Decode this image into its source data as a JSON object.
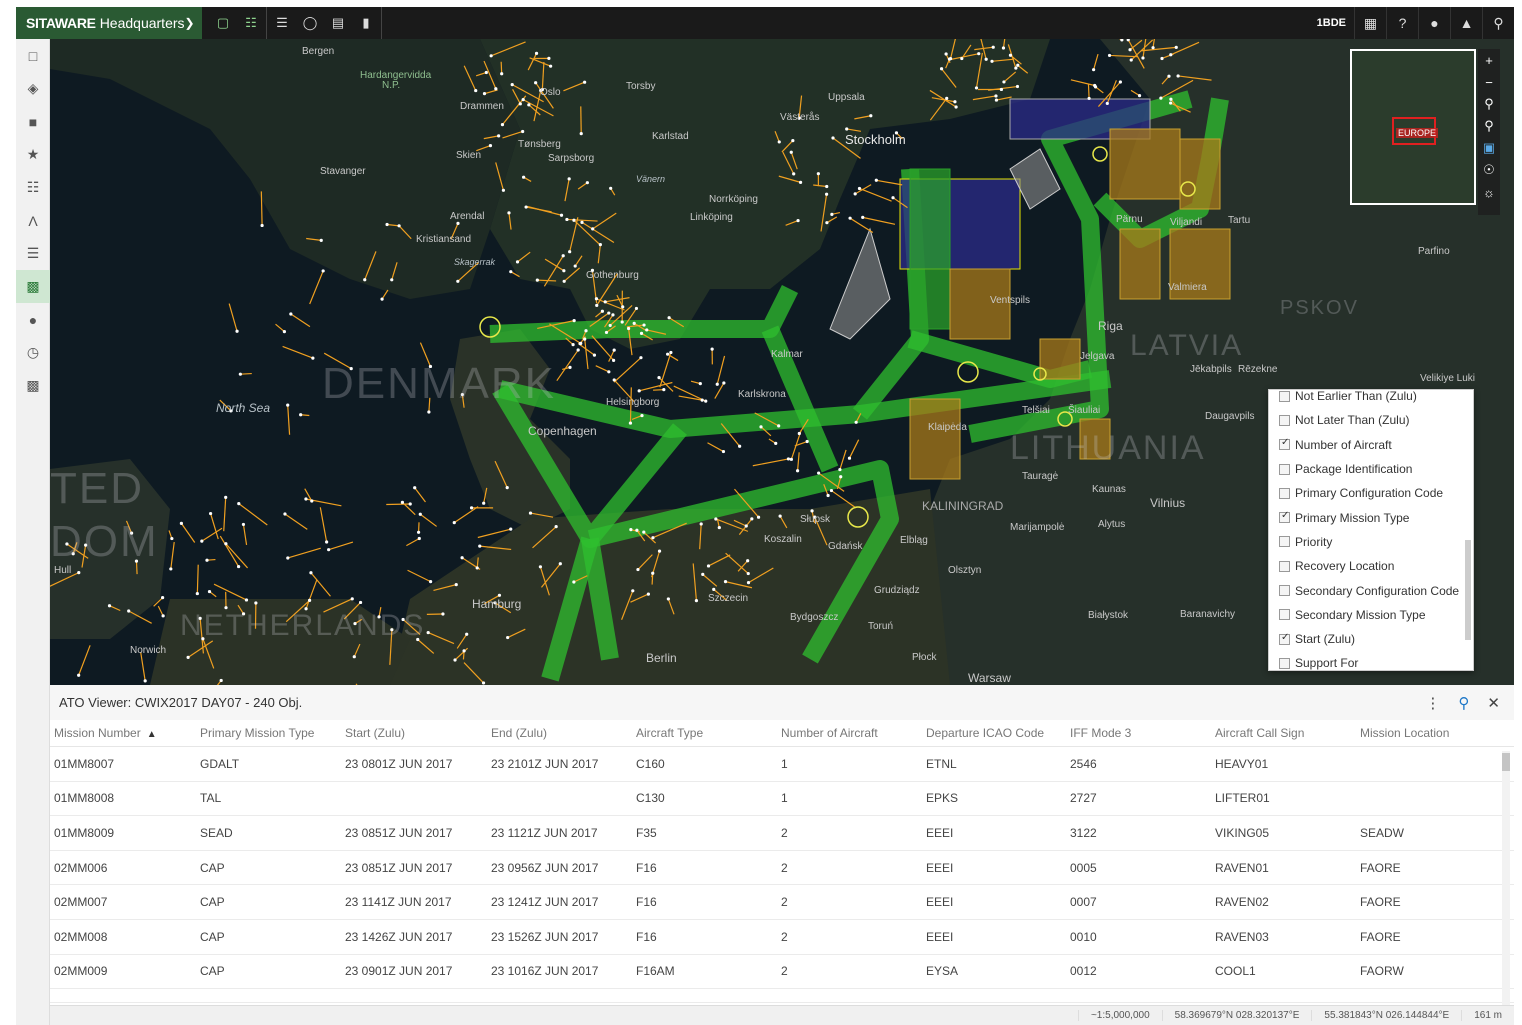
{
  "app": {
    "brand_bold": "SITAWARE",
    "brand_rest": "Headquarters",
    "unit": "1BDE"
  },
  "icons": {
    "toolbar": [
      "map-icon",
      "hierarchy-icon",
      "layers-list-icon",
      "chat-icon",
      "document-icon",
      "bookmark-icon"
    ],
    "sidebar": [
      "map-icon",
      "layers-icon",
      "shapes-icon",
      "star-icon",
      "hierarchy-icon",
      "route-icon",
      "stack-icon",
      "ato-icon",
      "people-icon",
      "history-icon",
      "print-icon"
    ]
  },
  "map": {
    "labels": {
      "denmark": "DENMARK",
      "netherlands": "NETHERLANDS",
      "united_kingdom_a": "TED",
      "united_kingdom_b": "DOM",
      "lithuania": "LITHUANIA",
      "latvia": "LATVIA",
      "pskov": "PSKOV",
      "north_sea": "North Sea",
      "stockholm": "Stockholm",
      "copenhagen": "Copenhagen",
      "riga": "Riga",
      "kaliningrad": "KALININGRAD",
      "warsaw": "Warsaw",
      "berlin": "Berlin",
      "hamburg": "Hamburg",
      "bergen": "Bergen",
      "oslo": "Oslo",
      "stavanger": "Stavanger",
      "gothenburg": "Gothenburg",
      "norrkoping": "Norrköping",
      "linkoping": "Linköping",
      "uppsala": "Uppsala",
      "vasteras": "Västerås",
      "karlstad": "Karlstad",
      "kalmar": "Kalmar",
      "karlskrona": "Karlskrona",
      "helsingborg": "Helsingborg",
      "klaipeda": "Klaipėda",
      "kaunas": "Kaunas",
      "vilnius": "Vilnius",
      "daugavpils": "Daugavpils",
      "olsztyn": "Olsztyn",
      "gdansk": "Gdańsk",
      "slupsk": "Słupsk",
      "bialystok": "Białystok",
      "plock": "Płock",
      "szczecin": "Szczecin",
      "bydgoszcz": "Bydgoszcz",
      "torun": "Toruń",
      "grudziadz": "Grudziądz",
      "koszalin": "Koszalin",
      "elblag": "Elbląg",
      "kristiansand": "Kristiansand",
      "skagerrak": "Skagerrak",
      "torsby": "Torsby",
      "tonsberg": "Tønsberg",
      "sarpsborg": "Sarpsborg",
      "drammen": "Drammen",
      "skien": "Skien",
      "arendal": "Arendal",
      "valmiera": "Valmiera",
      "jekabpils": "Jēkabpils",
      "rezekne": "Rēzekne",
      "jelgava": "Jelgava",
      "taurage": "Tauragė",
      "siauliai": "Šiauliai",
      "telsiai": "Telšiai",
      "ventspils": "Ventspils",
      "parnu": "Pärnu",
      "viljandi": "Viljandi",
      "tartu": "Tartu",
      "parfino": "Parfino",
      "velikiye_luki": "Velikiye Luki",
      "baranavichy": "Baranavichy",
      "alytus": "Alytus",
      "marijampole": "Marijampolė",
      "vanern": "Vänern",
      "hardangervidda": "Hardangervidda",
      "hardangervidda_np": "N.P.",
      "norwich": "Norwich",
      "hull": "Hull"
    },
    "overview_label": "EUROPE",
    "zoom_icons": [
      "zoom-in-icon",
      "zoom-out-icon",
      "zoom-extent-icon",
      "zoom-select-icon",
      "window-icon",
      "globe-icon",
      "brightness-icon"
    ]
  },
  "column_chooser": {
    "items": [
      {
        "label": "Not Earlier Than (Zulu)",
        "checked": false
      },
      {
        "label": "Not Later Than (Zulu)",
        "checked": false
      },
      {
        "label": "Number of Aircraft",
        "checked": true
      },
      {
        "label": "Package Identification",
        "checked": false
      },
      {
        "label": "Primary Configuration Code",
        "checked": false
      },
      {
        "label": "Primary Mission Type",
        "checked": true
      },
      {
        "label": "Priority",
        "checked": false
      },
      {
        "label": "Recovery Location",
        "checked": false
      },
      {
        "label": "Secondary Configuration Code",
        "checked": false
      },
      {
        "label": "Secondary Mission Type",
        "checked": false
      },
      {
        "label": "Start (Zulu)",
        "checked": true
      },
      {
        "label": "Support For",
        "checked": false
      }
    ]
  },
  "ato": {
    "title": "ATO Viewer: CWIX2017 DAY07 - 240 Obj.",
    "columns": [
      "Mission Number",
      "Primary Mission Type",
      "Start (Zulu)",
      "End (Zulu)",
      "Aircraft Type",
      "Number of Aircraft",
      "Departure ICAO Code",
      "IFF Mode 3",
      "Aircraft Call Sign",
      "Mission Location"
    ],
    "sort_indicator": "▲",
    "rows": [
      [
        "01MM8007",
        "GDALT",
        "23 0801Z JUN 2017",
        "23 2101Z JUN 2017",
        "C160",
        "1",
        "ETNL",
        "2546",
        "HEAVY01",
        ""
      ],
      [
        "01MM8008",
        "TAL",
        "",
        "",
        "C130",
        "1",
        "EPKS",
        "2727",
        "LIFTER01",
        ""
      ],
      [
        "01MM8009",
        "SEAD",
        "23 0851Z JUN 2017",
        "23 1121Z JUN 2017",
        "F35",
        "2",
        "EEEI",
        "3122",
        "VIKING05",
        "SEADW"
      ],
      [
        "02MM006",
        "CAP",
        "23 0851Z JUN 2017",
        "23 0956Z JUN 2017",
        "F16",
        "2",
        "EEEI",
        "0005",
        "RAVEN01",
        "FAORE"
      ],
      [
        "02MM007",
        "CAP",
        "23 1141Z JUN 2017",
        "23 1241Z JUN 2017",
        "F16",
        "2",
        "EEEI",
        "0007",
        "RAVEN02",
        "FAORE"
      ],
      [
        "02MM008",
        "CAP",
        "23 1426Z JUN 2017",
        "23 1526Z JUN 2017",
        "F16",
        "2",
        "EEEI",
        "0010",
        "RAVEN03",
        "FAORE"
      ],
      [
        "02MM009",
        "CAP",
        "23 0901Z JUN 2017",
        "23 1016Z JUN 2017",
        "F16AM",
        "2",
        "EYSA",
        "0012",
        "COOL1",
        "FAORW"
      ]
    ]
  },
  "status": {
    "scale": "~1:5,000,000",
    "coord1": "58.369679°N 028.320137°E",
    "coord2": "55.381843°N 026.144844°E",
    "elevation": "161 m"
  }
}
